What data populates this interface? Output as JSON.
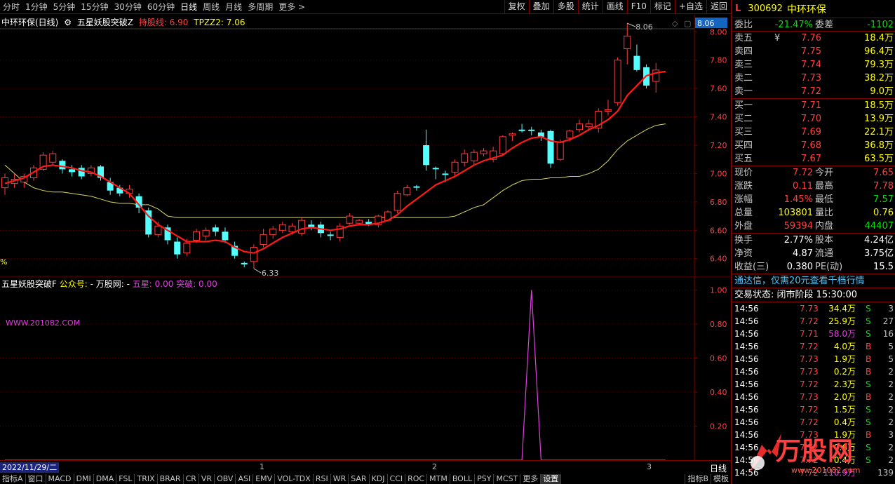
{
  "toolbar": {
    "periods": [
      "分时",
      "1分钟",
      "5分钟",
      "15分钟",
      "30分钟",
      "60分钟",
      "日线",
      "周线",
      "月线",
      "多周期",
      "更多 >"
    ],
    "active_period": "日线",
    "tools": [
      "复权",
      "叠加",
      "多股",
      "统计",
      "画线",
      "F10",
      "标记",
      "+自选",
      "返回"
    ]
  },
  "main_chart": {
    "stock_title": "中环环保(日线)",
    "indicator_name": "五星妖股突破Z",
    "hold_line_label": "持股线: 6.90",
    "tpzz2_label": "TPZZ2: 7.06",
    "price_tag": "8.06",
    "high_marker": "8.06",
    "low_marker": "6.33",
    "pct_label": "%",
    "y_ticks": [
      "8.00",
      "7.80",
      "7.60",
      "7.40",
      "7.20",
      "7.00",
      "6.80",
      "6.60",
      "6.40"
    ]
  },
  "indicator_panel": {
    "title": "五星妖股突破F",
    "gzh_label": "公众号: -",
    "site_label": "万股网: -",
    "wuxing_label": "五星: 0.00",
    "tupo_label": "突破: 0.00",
    "watermark": "WWW.201082.COM",
    "y_ticks": [
      "1.00",
      "0.80",
      "0.60",
      "0.40",
      "0.20"
    ]
  },
  "date_strip": {
    "current_date": "2022/11/29/二",
    "month_marks": [
      "1",
      "2",
      "3"
    ],
    "period_label": "日线"
  },
  "bottom_tabs": [
    "指标A",
    "窗口",
    "MACD",
    "DMI",
    "DMA",
    "FSL",
    "TRIX",
    "BRAR",
    "CR",
    "VR",
    "OBV",
    "ASI",
    "EMV",
    "VOL-TDX",
    "RSI",
    "WR",
    "SAR",
    "KDJ",
    "CCI",
    "ROC",
    "MTM",
    "BOLL",
    "PSY",
    "MCST",
    "更多",
    "设置"
  ],
  "bottom_right_tabs": [
    "指标B",
    "模板"
  ],
  "quote": {
    "mark": "L",
    "code": "300692",
    "name": "中环环保",
    "weibi_label": "委比",
    "weibi": "-21.47%",
    "weicha_label": "委差",
    "weicha": "-1102",
    "asks": [
      {
        "label": "卖五",
        "flag": "¥",
        "price": "7.76",
        "vol": "18.4万"
      },
      {
        "label": "卖四",
        "flag": "",
        "price": "7.75",
        "vol": "96.4万"
      },
      {
        "label": "卖三",
        "flag": "",
        "price": "7.74",
        "vol": "79.3万"
      },
      {
        "label": "卖二",
        "flag": "",
        "price": "7.73",
        "vol": "38.2万"
      },
      {
        "label": "卖一",
        "flag": "",
        "price": "7.72",
        "vol": "9.0万"
      }
    ],
    "bids": [
      {
        "label": "买一",
        "price": "7.71",
        "vol": "18.5万"
      },
      {
        "label": "买二",
        "price": "7.70",
        "vol": "13.9万"
      },
      {
        "label": "买三",
        "price": "7.69",
        "vol": "22.1万"
      },
      {
        "label": "买四",
        "price": "7.68",
        "vol": "36.8万"
      },
      {
        "label": "买五",
        "price": "7.67",
        "vol": "63.5万"
      }
    ],
    "stats": [
      {
        "l1": "现价",
        "v1": "7.72",
        "c1": "red",
        "l2": "今开",
        "v2": "7.65",
        "c2": "red"
      },
      {
        "l1": "涨跌",
        "v1": "0.11",
        "c1": "red",
        "l2": "最高",
        "v2": "7.78",
        "c2": "red"
      },
      {
        "l1": "涨幅",
        "v1": "1.45%",
        "c1": "red",
        "l2": "最低",
        "v2": "7.57",
        "c2": "green"
      },
      {
        "l1": "总量",
        "v1": "103801",
        "c1": "yellow",
        "l2": "量比",
        "v2": "0.76",
        "c2": "yellow"
      },
      {
        "l1": "外盘",
        "v1": "59394",
        "c1": "red",
        "l2": "内盘",
        "v2": "44407",
        "c2": "green"
      }
    ],
    "stats2": [
      {
        "l1": "换手",
        "v1": "2.77%",
        "l2": "股本",
        "v2": "4.24亿"
      },
      {
        "l1": "净资",
        "v1": "4.87",
        "l2": "流通",
        "v2": "3.75亿"
      },
      {
        "l1": "收益(三)",
        "v1": "0.380",
        "l2": "PE(动)",
        "v2": "15.5"
      }
    ],
    "promo": "通达信，仅需20元查看千档行情",
    "trade_state_label": "交易状态: 闭市阶段",
    "trade_state_time": "15:30:00",
    "ticks": [
      {
        "time": "14:56",
        "price": "7.73",
        "vol": "34.4万",
        "bs": "S",
        "n": "3",
        "vc": "yellow"
      },
      {
        "time": "14:56",
        "price": "7.72",
        "vol": "25.9万",
        "bs": "S",
        "n": "27",
        "vc": "yellow"
      },
      {
        "time": "14:56",
        "price": "7.71",
        "vol": "58.0万",
        "bs": "S",
        "n": "16",
        "vc": "magenta"
      },
      {
        "time": "14:56",
        "price": "7.72",
        "vol": "4.0万",
        "bs": "B",
        "n": "5",
        "vc": "yellow"
      },
      {
        "time": "14:56",
        "price": "7.73",
        "vol": "1.9万",
        "bs": "B",
        "n": "5",
        "vc": "yellow"
      },
      {
        "time": "14:56",
        "price": "7.73",
        "vol": "0.2万",
        "bs": "B",
        "n": "2",
        "vc": "yellow"
      },
      {
        "time": "14:56",
        "price": "7.72",
        "vol": "2.3万",
        "bs": "S",
        "n": "2",
        "vc": "yellow"
      },
      {
        "time": "14:56",
        "price": "7.73",
        "vol": "2.0万",
        "bs": "B",
        "n": "2",
        "vc": "yellow"
      },
      {
        "time": "14:56",
        "price": "7.72",
        "vol": "1.5万",
        "bs": "S",
        "n": "2",
        "vc": "yellow"
      },
      {
        "time": "14:56",
        "price": "7.72",
        "vol": "0.4万",
        "bs": "S",
        "n": "2",
        "vc": "yellow"
      },
      {
        "time": "14:56",
        "price": "7.73",
        "vol": "1.9万",
        "bs": "B",
        "n": "3",
        "vc": "yellow"
      },
      {
        "time": "14:56",
        "price": "7.72",
        "vol": "0.6万",
        "bs": "S",
        "n": "2",
        "vc": "yellow"
      },
      {
        "time": "14:56",
        "price": "7.72",
        "vol": "0.4万",
        "bs": "S",
        "n": "2",
        "vc": "yellow"
      },
      {
        "time": "14:56",
        "price": "7.72",
        "vol": "110.9万",
        "bs": "",
        "n": "139",
        "vc": "magenta"
      }
    ]
  },
  "brand": {
    "text": "万股网",
    "sub": "www.201082.com"
  },
  "colors": {
    "up": "#ff3b3b",
    "down": "#54ffff",
    "ma_line": "#ff1a1a",
    "hold_line": "#d8d860",
    "signal_line": "#e040e0",
    "grid_red": "#800000"
  },
  "chart_data": {
    "type": "candlestick",
    "ylim": [
      6.28,
      8.12
    ],
    "candles": [
      {
        "o": 6.9,
        "c": 6.97,
        "h": 7.0,
        "l": 6.85
      },
      {
        "o": 6.93,
        "c": 6.96,
        "h": 7.0,
        "l": 6.9
      },
      {
        "o": 6.94,
        "c": 6.98,
        "h": 7.0,
        "l": 6.9
      },
      {
        "o": 6.97,
        "c": 7.04,
        "h": 7.06,
        "l": 6.95
      },
      {
        "o": 7.03,
        "c": 7.13,
        "h": 7.15,
        "l": 7.02
      },
      {
        "o": 7.08,
        "c": 7.14,
        "h": 7.16,
        "l": 7.06
      },
      {
        "o": 7.09,
        "c": 7.03,
        "h": 7.1,
        "l": 7.0
      },
      {
        "o": 7.03,
        "c": 7.01,
        "h": 7.06,
        "l": 6.98
      },
      {
        "o": 7.04,
        "c": 6.98,
        "h": 7.06,
        "l": 6.96
      },
      {
        "o": 7.0,
        "c": 7.04,
        "h": 7.06,
        "l": 6.98
      },
      {
        "o": 7.05,
        "c": 6.97,
        "h": 7.06,
        "l": 6.95
      },
      {
        "o": 6.94,
        "c": 6.88,
        "h": 6.97,
        "l": 6.85
      },
      {
        "o": 6.9,
        "c": 6.86,
        "h": 6.92,
        "l": 6.84
      },
      {
        "o": 6.86,
        "c": 6.89,
        "h": 6.92,
        "l": 6.83
      },
      {
        "o": 6.84,
        "c": 6.76,
        "h": 6.86,
        "l": 6.72
      },
      {
        "o": 6.74,
        "c": 6.57,
        "h": 6.76,
        "l": 6.55
      },
      {
        "o": 6.57,
        "c": 6.63,
        "h": 6.66,
        "l": 6.55
      },
      {
        "o": 6.62,
        "c": 6.53,
        "h": 6.64,
        "l": 6.5
      },
      {
        "o": 6.52,
        "c": 6.43,
        "h": 6.55,
        "l": 6.4
      },
      {
        "o": 6.44,
        "c": 6.51,
        "h": 6.54,
        "l": 6.42
      },
      {
        "o": 6.53,
        "c": 6.59,
        "h": 6.61,
        "l": 6.51
      },
      {
        "o": 6.56,
        "c": 6.6,
        "h": 6.62,
        "l": 6.53
      },
      {
        "o": 6.62,
        "c": 6.59,
        "h": 6.64,
        "l": 6.56
      },
      {
        "o": 6.59,
        "c": 6.53,
        "h": 6.62,
        "l": 6.51
      },
      {
        "o": 6.49,
        "c": 6.42,
        "h": 6.52,
        "l": 6.4
      },
      {
        "o": 6.37,
        "c": 6.36,
        "h": 6.38,
        "l": 6.34
      },
      {
        "o": 6.38,
        "c": 6.48,
        "h": 6.5,
        "l": 6.33
      },
      {
        "o": 6.5,
        "c": 6.57,
        "h": 6.61,
        "l": 6.48
      },
      {
        "o": 6.57,
        "c": 6.61,
        "h": 6.63,
        "l": 6.54
      },
      {
        "o": 6.6,
        "c": 6.64,
        "h": 6.66,
        "l": 6.58
      },
      {
        "o": 6.59,
        "c": 6.63,
        "h": 6.65,
        "l": 6.57
      },
      {
        "o": 6.58,
        "c": 6.67,
        "h": 6.69,
        "l": 6.56
      },
      {
        "o": 6.64,
        "c": 6.62,
        "h": 6.67,
        "l": 6.6
      },
      {
        "o": 6.64,
        "c": 6.58,
        "h": 6.66,
        "l": 6.55
      },
      {
        "o": 6.57,
        "c": 6.56,
        "h": 6.59,
        "l": 6.53
      },
      {
        "o": 6.55,
        "c": 6.63,
        "h": 6.65,
        "l": 6.52
      },
      {
        "o": 6.65,
        "c": 6.7,
        "h": 6.72,
        "l": 6.64
      },
      {
        "o": 6.65,
        "c": 6.67,
        "h": 6.68,
        "l": 6.64
      },
      {
        "o": 6.66,
        "c": 6.64,
        "h": 6.68,
        "l": 6.63
      },
      {
        "o": 6.64,
        "c": 6.7,
        "h": 6.71,
        "l": 6.62
      },
      {
        "o": 6.67,
        "c": 6.73,
        "h": 6.74,
        "l": 6.66
      },
      {
        "o": 6.74,
        "c": 6.86,
        "h": 6.88,
        "l": 6.72
      },
      {
        "o": 6.85,
        "c": 6.9,
        "h": 6.92,
        "l": 6.84
      },
      {
        "o": 6.91,
        "c": 6.9,
        "h": 6.92,
        "l": 6.88
      },
      {
        "o": 7.2,
        "c": 7.06,
        "h": 7.31,
        "l": 7.02
      },
      {
        "o": 7.04,
        "c": 7.03,
        "h": 7.05,
        "l": 6.96
      },
      {
        "o": 7.0,
        "c": 6.99,
        "h": 7.02,
        "l": 6.94
      },
      {
        "o": 7.01,
        "c": 7.08,
        "h": 7.1,
        "l": 6.98
      },
      {
        "o": 7.08,
        "c": 7.14,
        "h": 7.17,
        "l": 7.05
      },
      {
        "o": 7.09,
        "c": 7.15,
        "h": 7.17,
        "l": 7.06
      },
      {
        "o": 7.14,
        "c": 7.16,
        "h": 7.18,
        "l": 7.12
      },
      {
        "o": 7.1,
        "c": 7.16,
        "h": 7.19,
        "l": 7.08
      },
      {
        "o": 7.14,
        "c": 7.26,
        "h": 7.27,
        "l": 7.13
      },
      {
        "o": 7.27,
        "c": 7.28,
        "h": 7.29,
        "l": 7.23
      },
      {
        "o": 7.31,
        "c": 7.3,
        "h": 7.35,
        "l": 7.29
      },
      {
        "o": 7.31,
        "c": 7.3,
        "h": 7.33,
        "l": 7.27
      },
      {
        "o": 7.29,
        "c": 7.26,
        "h": 7.31,
        "l": 7.23
      },
      {
        "o": 7.3,
        "c": 7.07,
        "h": 7.31,
        "l": 7.04
      },
      {
        "o": 7.1,
        "c": 7.22,
        "h": 7.24,
        "l": 7.09
      },
      {
        "o": 7.25,
        "c": 7.3,
        "h": 7.31,
        "l": 7.23
      },
      {
        "o": 7.31,
        "c": 7.35,
        "h": 7.38,
        "l": 7.29
      },
      {
        "o": 7.33,
        "c": 7.35,
        "h": 7.38,
        "l": 7.3
      },
      {
        "o": 7.32,
        "c": 7.44,
        "h": 7.46,
        "l": 7.29
      },
      {
        "o": 7.44,
        "c": 7.45,
        "h": 7.52,
        "l": 7.41
      },
      {
        "o": 7.5,
        "c": 7.8,
        "h": 7.82,
        "l": 7.48
      },
      {
        "o": 7.88,
        "c": 7.97,
        "h": 8.06,
        "l": 7.77
      },
      {
        "o": 7.83,
        "c": 7.73,
        "h": 7.91,
        "l": 7.72
      },
      {
        "o": 7.75,
        "c": 7.62,
        "h": 7.77,
        "l": 7.6
      },
      {
        "o": 7.65,
        "c": 7.73,
        "h": 7.78,
        "l": 7.57
      }
    ],
    "ma": [
      6.93,
      6.95,
      6.97,
      7.01,
      7.05,
      7.06,
      7.05,
      7.04,
      7.02,
      7.01,
      6.98,
      6.94,
      6.9,
      6.86,
      6.78,
      6.7,
      6.64,
      6.6,
      6.56,
      6.52,
      6.52,
      6.52,
      6.53,
      6.52,
      6.48,
      6.45,
      6.44,
      6.47,
      6.51,
      6.55,
      6.58,
      6.61,
      6.62,
      6.61,
      6.6,
      6.61,
      6.63,
      6.64,
      6.64,
      6.65,
      6.67,
      6.71,
      6.77,
      6.82,
      6.87,
      6.92,
      6.95,
      6.98,
      7.02,
      7.06,
      7.09,
      7.11,
      7.13,
      7.18,
      7.22,
      7.25,
      7.26,
      7.23,
      7.22,
      7.24,
      7.27,
      7.31,
      7.34,
      7.38,
      7.44,
      7.55,
      7.62,
      7.69,
      7.71,
      7.72
    ],
    "hold_line": [
      7.06,
      7.0,
      6.94,
      6.9,
      6.88,
      6.87,
      6.87,
      6.86,
      6.85,
      6.84,
      6.82,
      6.8,
      6.79,
      6.79,
      6.78,
      6.78,
      6.75,
      6.7,
      6.69,
      6.69,
      6.69,
      6.69,
      6.69,
      6.69,
      6.69,
      6.69,
      6.69,
      6.69,
      6.69,
      6.69,
      6.69,
      6.69,
      6.69,
      6.69,
      6.69,
      6.69,
      6.69,
      6.69,
      6.69,
      6.69,
      6.69,
      6.69,
      6.69,
      6.69,
      6.69,
      6.69,
      6.69,
      6.7,
      6.73,
      6.76,
      6.78,
      6.83,
      6.88,
      6.92,
      6.95,
      6.96,
      6.96,
      6.97,
      6.97,
      6.98,
      6.98,
      7.0,
      7.03,
      7.09,
      7.17,
      7.23,
      7.27,
      7.31,
      7.34,
      7.35
    ],
    "signal": {
      "x": [
        0,
        54,
        55,
        56,
        69
      ],
      "y": [
        0,
        0,
        1,
        0,
        0
      ],
      "ylim": [
        0,
        1.08
      ]
    }
  }
}
